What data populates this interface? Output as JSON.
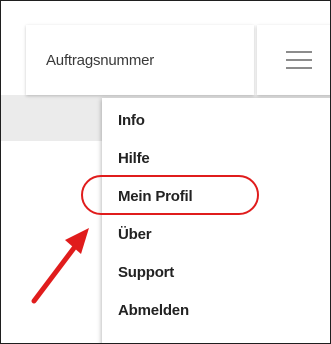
{
  "order_field": {
    "label": "Auftragsnummer"
  },
  "menu_button": {
    "icon": "hamburger-menu-icon"
  },
  "dropdown": {
    "items": [
      {
        "label": "Info"
      },
      {
        "label": "Hilfe"
      },
      {
        "label": "Mein Profil",
        "highlighted": true
      },
      {
        "label": "Über"
      },
      {
        "label": "Support"
      },
      {
        "label": "Abmelden"
      }
    ]
  },
  "annotation": {
    "highlight_color": "#e01c1c",
    "arrow_color": "#e01c1c",
    "target": "Mein Profil"
  }
}
